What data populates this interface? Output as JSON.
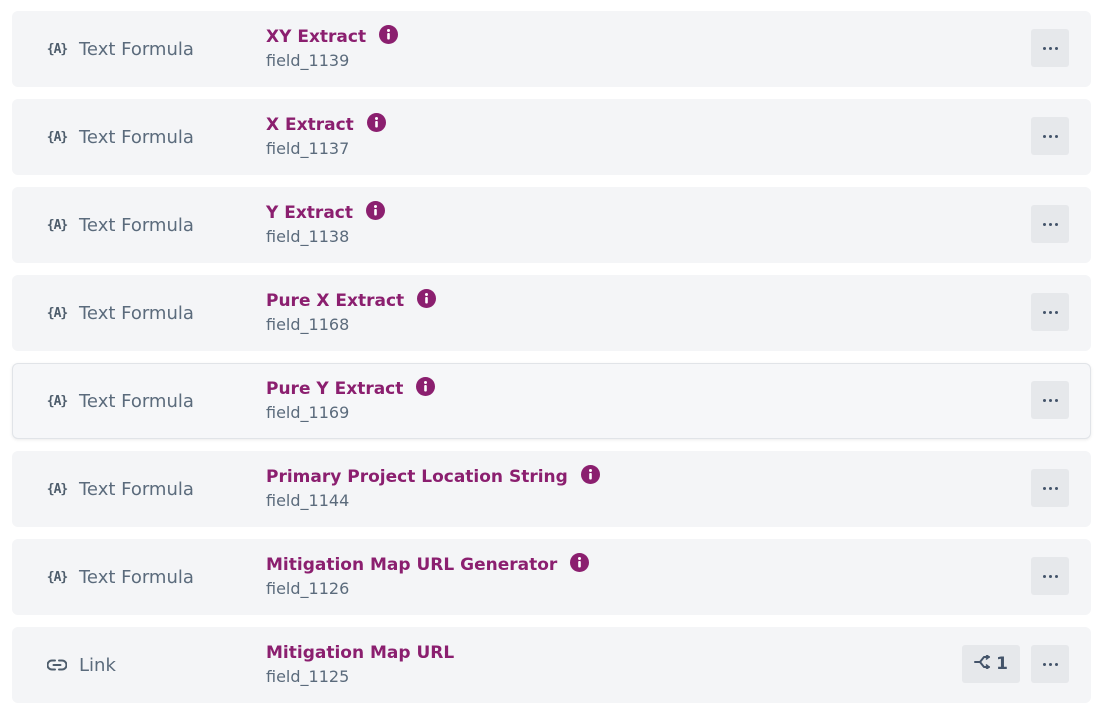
{
  "fields": [
    {
      "type_label": "Text Formula",
      "type_icon": "formula-icon",
      "name": "XY Extract",
      "key": "field_1139",
      "has_info": true
    },
    {
      "type_label": "Text Formula",
      "type_icon": "formula-icon",
      "name": "X Extract",
      "key": "field_1137",
      "has_info": true
    },
    {
      "type_label": "Text Formula",
      "type_icon": "formula-icon",
      "name": "Y Extract",
      "key": "field_1138",
      "has_info": true
    },
    {
      "type_label": "Text Formula",
      "type_icon": "formula-icon",
      "name": "Pure X Extract",
      "key": "field_1168",
      "has_info": true
    },
    {
      "type_label": "Text Formula",
      "type_icon": "formula-icon",
      "name": "Pure Y Extract",
      "key": "field_1169",
      "has_info": true
    },
    {
      "type_label": "Text Formula",
      "type_icon": "formula-icon",
      "name": "Primary Project Location String",
      "key": "field_1144",
      "has_info": true
    },
    {
      "type_label": "Text Formula",
      "type_icon": "formula-icon",
      "name": "Mitigation Map URL Generator",
      "key": "field_1126",
      "has_info": true
    },
    {
      "type_label": "Link",
      "type_icon": "link-icon",
      "name": "Mitigation Map URL",
      "key": "field_1125",
      "has_info": false,
      "connections_count": "1"
    }
  ],
  "formula_glyph": "{A}",
  "colors": {
    "accent": "#8b1f6f",
    "row_bg": "#f4f5f7",
    "muted_text": "#5b6b7c",
    "button_bg": "#e6e8eb"
  }
}
